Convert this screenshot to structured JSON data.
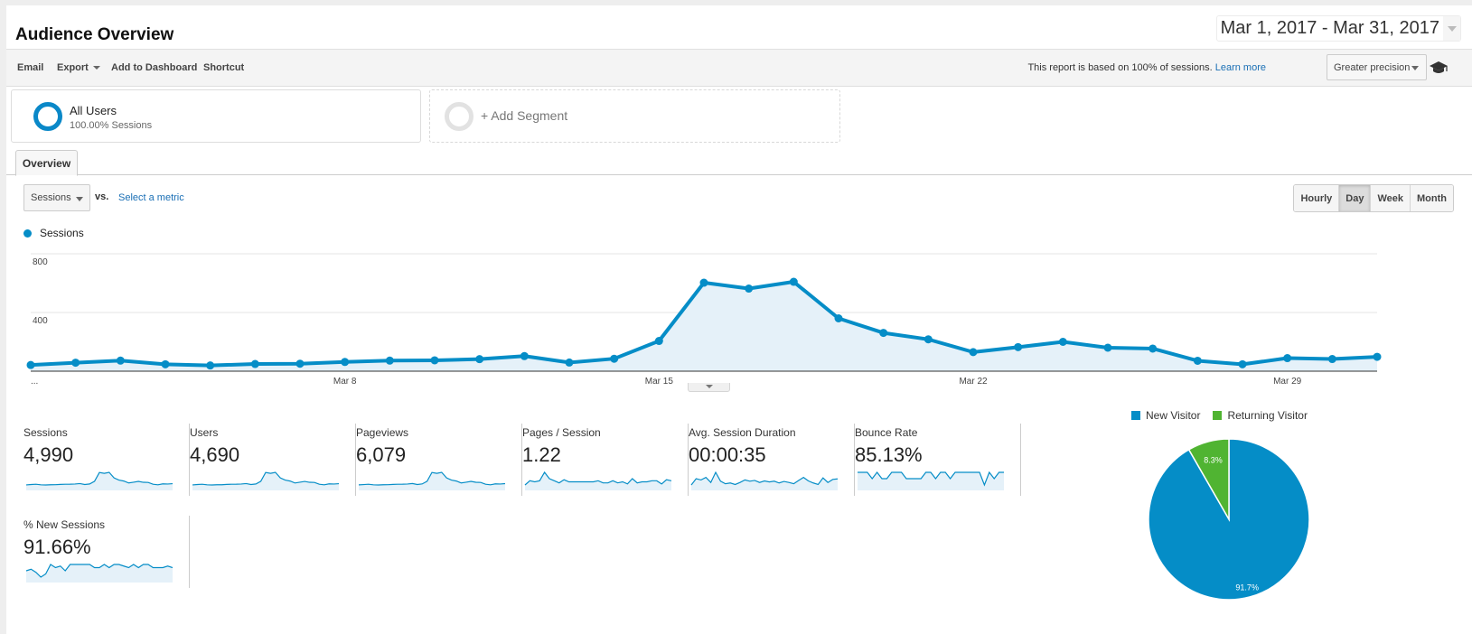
{
  "header": {
    "title": "Audience Overview",
    "date_range": "Mar 1, 2017 - Mar 31, 2017"
  },
  "toolbar": {
    "email": "Email",
    "export": "Export",
    "add_to_dashboard": "Add to Dashboard",
    "shortcut": "Shortcut",
    "sampling_text": "This report is based on 100% of sessions.",
    "learn_more": "Learn more",
    "precision": "Greater precision",
    "icon": "graduation-cap-icon"
  },
  "segments": {
    "all_users": {
      "name": "All Users",
      "sub": "100.00% Sessions"
    },
    "add_segment": "+ Add Segment"
  },
  "tabs": [
    {
      "label": "Overview",
      "active": true
    }
  ],
  "controls": {
    "metric": "Sessions",
    "vs": "vs.",
    "select_metric": "Select a metric",
    "granularity": [
      {
        "label": "Hourly",
        "active": false
      },
      {
        "label": "Day",
        "active": true
      },
      {
        "label": "Week",
        "active": false
      },
      {
        "label": "Month",
        "active": false
      }
    ]
  },
  "colors": {
    "accent": "#058dc7",
    "fill": "#e5f1f9",
    "returning": "#50b432",
    "link": "#1a6fb5"
  },
  "chart_data": {
    "type": "area",
    "title": "",
    "legend": [
      "Sessions"
    ],
    "legend_position": "top-left",
    "x": [
      "Mar 1",
      "Mar 2",
      "Mar 3",
      "Mar 4",
      "Mar 5",
      "Mar 6",
      "Mar 7",
      "Mar 8",
      "Mar 9",
      "Mar 10",
      "Mar 11",
      "Mar 12",
      "Mar 13",
      "Mar 14",
      "Mar 15",
      "Mar 16",
      "Mar 17",
      "Mar 18",
      "Mar 19",
      "Mar 20",
      "Mar 21",
      "Mar 22",
      "Mar 23",
      "Mar 24",
      "Mar 25",
      "Mar 26",
      "Mar 27",
      "Mar 28",
      "Mar 29",
      "Mar 30",
      "Mar 31"
    ],
    "series": [
      {
        "name": "Sessions",
        "values": [
          42,
          58,
          72,
          47,
          39,
          49,
          51,
          63,
          72,
          74,
          82,
          103,
          59,
          85,
          206,
          603,
          563,
          609,
          360,
          261,
          217,
          130,
          164,
          200,
          160,
          154,
          71,
          47,
          89,
          83,
          98
        ]
      }
    ],
    "x_tick_labels": [
      "...",
      "Mar 8",
      "Mar 15",
      "Mar 22",
      "Mar 29"
    ],
    "y_tick_labels": [
      "400",
      "800"
    ],
    "ylim": [
      0,
      800
    ],
    "grid": true
  },
  "metrics": [
    {
      "label": "Sessions",
      "value": "4,990",
      "spark": [
        42,
        58,
        72,
        47,
        39,
        49,
        51,
        63,
        72,
        74,
        82,
        103,
        59,
        85,
        206,
        603,
        563,
        609,
        360,
        261,
        217,
        130,
        164,
        200,
        160,
        154,
        71,
        47,
        89,
        83,
        98
      ]
    },
    {
      "label": "Users",
      "value": "4,690",
      "spark": [
        40,
        55,
        68,
        45,
        37,
        46,
        48,
        60,
        68,
        70,
        77,
        96,
        56,
        80,
        195,
        570,
        532,
        575,
        340,
        246,
        205,
        122,
        155,
        188,
        151,
        145,
        67,
        44,
        84,
        78,
        92
      ]
    },
    {
      "label": "Pageviews",
      "value": "6,079",
      "spark": [
        52,
        70,
        88,
        57,
        47,
        60,
        62,
        77,
        88,
        90,
        100,
        126,
        72,
        104,
        251,
        736,
        687,
        743,
        439,
        318,
        265,
        159,
        200,
        244,
        195,
        188,
        87,
        57,
        109,
        101,
        120
      ]
    },
    {
      "label": "Pages / Session",
      "value": "1.22",
      "spark": [
        1.18,
        1.22,
        1.21,
        1.22,
        1.3,
        1.24,
        1.22,
        1.2,
        1.23,
        1.21,
        1.21,
        1.21,
        1.21,
        1.21,
        1.21,
        1.22,
        1.2,
        1.2,
        1.22,
        1.2,
        1.21,
        1.19,
        1.24,
        1.2,
        1.21,
        1.21,
        1.22,
        1.22,
        1.19,
        1.23,
        1.22
      ]
    },
    {
      "label": "Avg. Session Duration",
      "value": "00:00:35",
      "spark": [
        20,
        45,
        40,
        50,
        30,
        70,
        35,
        25,
        28,
        22,
        30,
        40,
        35,
        38,
        30,
        36,
        32,
        35,
        28,
        34,
        30,
        25,
        38,
        50,
        36,
        28,
        22,
        48,
        30,
        42,
        44
      ]
    },
    {
      "label": "Bounce Rate",
      "value": "85.13%",
      "spark": [
        86,
        86,
        86,
        85,
        86,
        85,
        85,
        86,
        86,
        86,
        85,
        85,
        85,
        85,
        86,
        86,
        85,
        86,
        86,
        85,
        86,
        86,
        86,
        86,
        86,
        86,
        84,
        86,
        85,
        86,
        86
      ]
    },
    {
      "label": "% New Sessions",
      "value": "91.66%",
      "spark": [
        91,
        91.5,
        90.5,
        89,
        90,
        93,
        92,
        92.5,
        91,
        93,
        93,
        93,
        93,
        93,
        92,
        92,
        93,
        92,
        93,
        93,
        92.5,
        92,
        93,
        92,
        93,
        93,
        92,
        92,
        92,
        92.5,
        92
      ]
    }
  ],
  "pie": {
    "legend": [
      {
        "label": "New Visitor",
        "color": "#058dc7"
      },
      {
        "label": "Returning Visitor",
        "color": "#50b432"
      }
    ],
    "slices": [
      {
        "label": "New Visitor",
        "value": 91.7,
        "text": "91.7%"
      },
      {
        "label": "Returning Visitor",
        "value": 8.3,
        "text": "8.3%"
      }
    ]
  }
}
